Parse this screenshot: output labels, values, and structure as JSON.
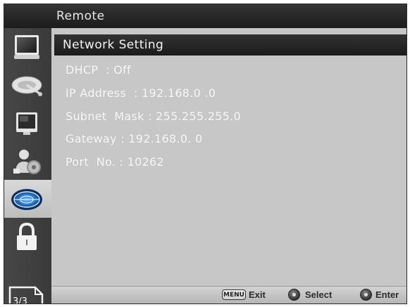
{
  "header": {
    "title": "Remote"
  },
  "section": {
    "title": "Network Setting"
  },
  "settings": [
    {
      "text": "DHCP  : Off"
    },
    {
      "text": "IP Address  : 192.168.0 .0"
    },
    {
      "text": "Subnet  Mask : 255.255.255.0"
    },
    {
      "text": "Gateway : 192.168.0. 0"
    },
    {
      "text": "Port  No. : 10262"
    }
  ],
  "sidebar": {
    "items": [
      {
        "icon": "monitor-icon"
      },
      {
        "icon": "satellite-dish-icon"
      },
      {
        "icon": "display-screen-icon"
      },
      {
        "icon": "user-settings-icon"
      },
      {
        "icon": "remote-network-icon",
        "active": true
      },
      {
        "icon": "lock-icon"
      }
    ],
    "page": "3/3"
  },
  "footer": {
    "menu_key": "MENU",
    "exit_label": "Exit",
    "select_label": "Select",
    "enter_label": "Enter"
  },
  "colors": {
    "background": "#c7c7c7",
    "bar": "#222222",
    "text": "#ffffff"
  }
}
